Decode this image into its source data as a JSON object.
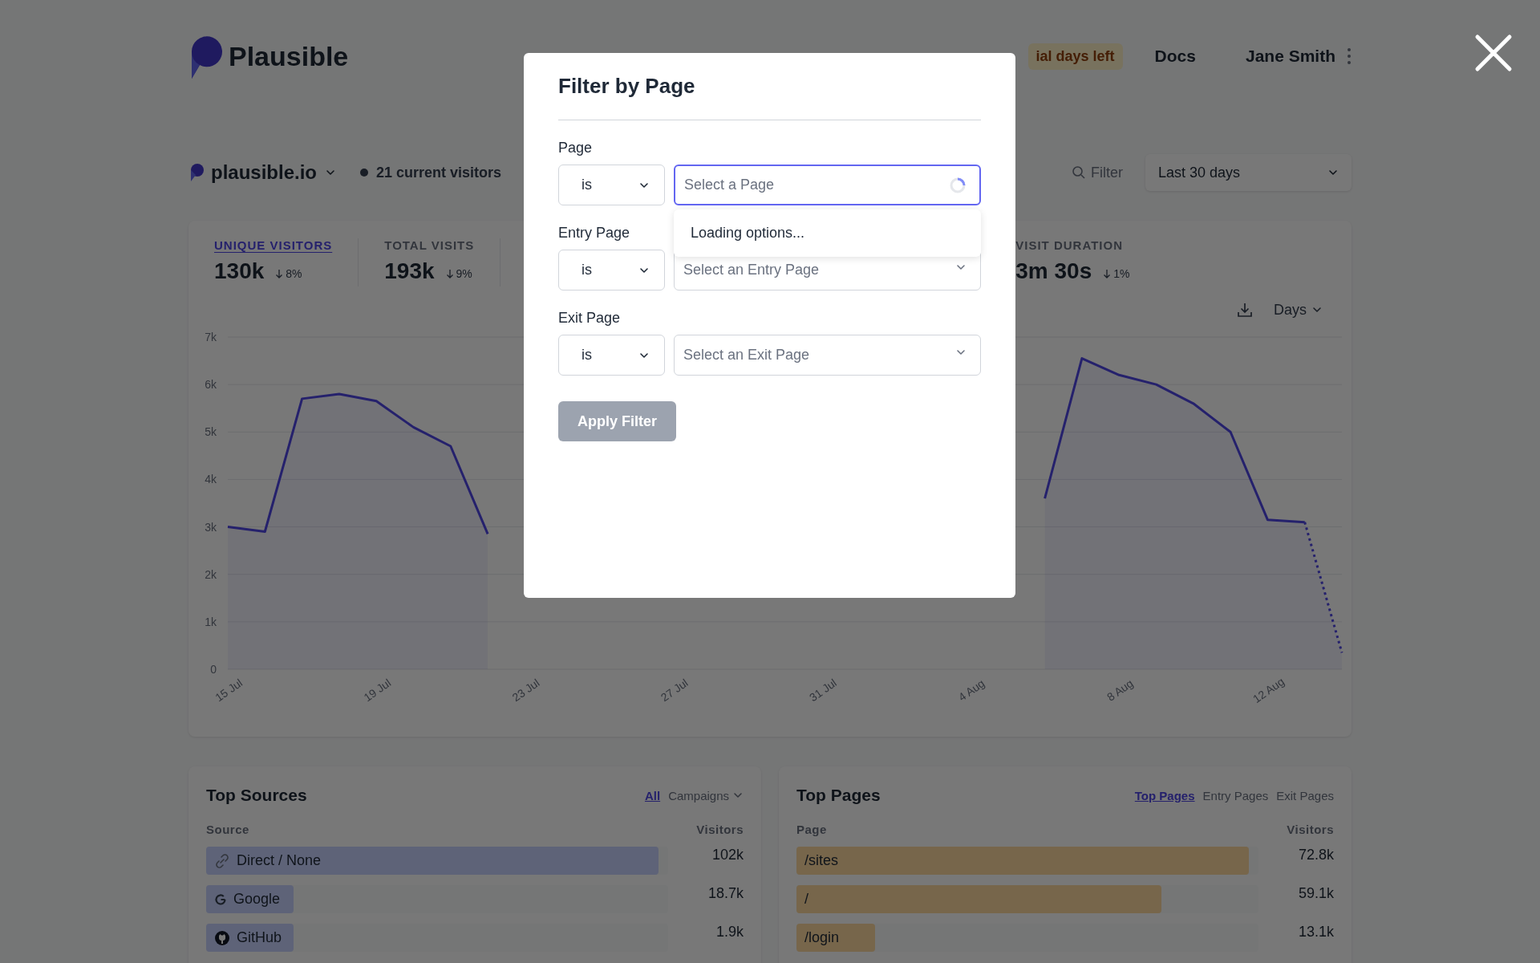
{
  "header": {
    "logo_text": "Plausible",
    "trial_badge": "ial days left",
    "docs_link": "Docs",
    "user_name": "Jane Smith"
  },
  "site_bar": {
    "site": "plausible.io",
    "current_visitors": "21 current visitors",
    "filter_label": "Filter",
    "period": "Last 30 days"
  },
  "stats": [
    {
      "label": "UNIQUE VISITORS",
      "value": "130k",
      "change": "8%",
      "selected": true
    },
    {
      "label": "TOTAL VISITS",
      "value": "193k",
      "change": "9%",
      "selected": false
    },
    {
      "label": "VISIT DURATION",
      "value": "3m 30s",
      "change": "1%",
      "selected": false
    }
  ],
  "chart": {
    "interval": "Days",
    "chart_data": {
      "type": "area",
      "categories": [
        "15 Jul",
        null,
        null,
        null,
        "19 Jul",
        null,
        null,
        null,
        "23 Jul",
        null,
        null,
        null,
        "27 Jul",
        null,
        null,
        null,
        "31 Jul",
        null,
        null,
        null,
        "4 Aug",
        null,
        null,
        null,
        "8 Aug",
        null,
        null,
        null,
        "12 Aug",
        null,
        null
      ],
      "ylim": [
        0,
        7000
      ],
      "grid": true,
      "yticks": [
        {
          "value": 0,
          "label": "0"
        },
        {
          "value": 1000,
          "label": "1k"
        },
        {
          "value": 2000,
          "label": "2k"
        },
        {
          "value": 3000,
          "label": "3k"
        },
        {
          "value": 4000,
          "label": "4k"
        },
        {
          "value": 5000,
          "label": "5k"
        },
        {
          "value": 6000,
          "label": "6k"
        },
        {
          "value": 7000,
          "label": "7k"
        }
      ],
      "series": [
        {
          "color": "#4f46e5",
          "values": [
            3000,
            2900,
            5700,
            5800,
            5650,
            5100,
            4700,
            2850,
            null,
            null,
            null,
            null,
            null,
            null,
            null,
            null,
            null,
            null,
            null,
            null,
            null,
            null,
            3600,
            6550,
            6200,
            6000,
            5600,
            5000,
            3150,
            3100,
            350
          ]
        }
      ]
    }
  },
  "top_sources": {
    "title": "Top Sources",
    "tabs": [
      {
        "label": "All",
        "selected": true,
        "has_menu": false
      },
      {
        "label": "Campaigns",
        "selected": false,
        "has_menu": true
      }
    ],
    "columns": [
      "Source",
      "Visitors"
    ],
    "rows": [
      {
        "name": "Direct / None",
        "value": "102k",
        "level": 0.98
      },
      {
        "name": "Google",
        "value": "18.7k",
        "level": 0.19
      },
      {
        "name": "GitHub",
        "value": "1.9k",
        "level": 0.19
      }
    ]
  },
  "top_pages": {
    "title": "Top Pages",
    "tabs": [
      {
        "label": "Top Pages",
        "selected": true
      },
      {
        "label": "Entry Pages",
        "selected": false
      },
      {
        "label": "Exit Pages",
        "selected": false
      }
    ],
    "columns": [
      "Page",
      "Visitors"
    ],
    "rows": [
      {
        "name": "/sites",
        "value": "72.8k",
        "level": 0.98
      },
      {
        "name": "/",
        "value": "59.1k",
        "level": 0.79
      },
      {
        "name": "/login",
        "value": "13.1k",
        "level": 0.17
      }
    ]
  },
  "modal": {
    "title": "Filter by Page",
    "filters": [
      {
        "label": "Page",
        "operator": "is",
        "placeholder": "Select a Page",
        "focused": true,
        "loading": true
      },
      {
        "label": "Entry Page",
        "operator": "is",
        "placeholder": "Select an Entry Page",
        "focused": false,
        "loading": false
      },
      {
        "label": "Exit Page",
        "operator": "is",
        "placeholder": "Select an Exit Page",
        "focused": false,
        "loading": false
      }
    ],
    "dropdown_message": "Loading options...",
    "apply_label": "Apply Filter",
    "apply_disabled": true
  }
}
